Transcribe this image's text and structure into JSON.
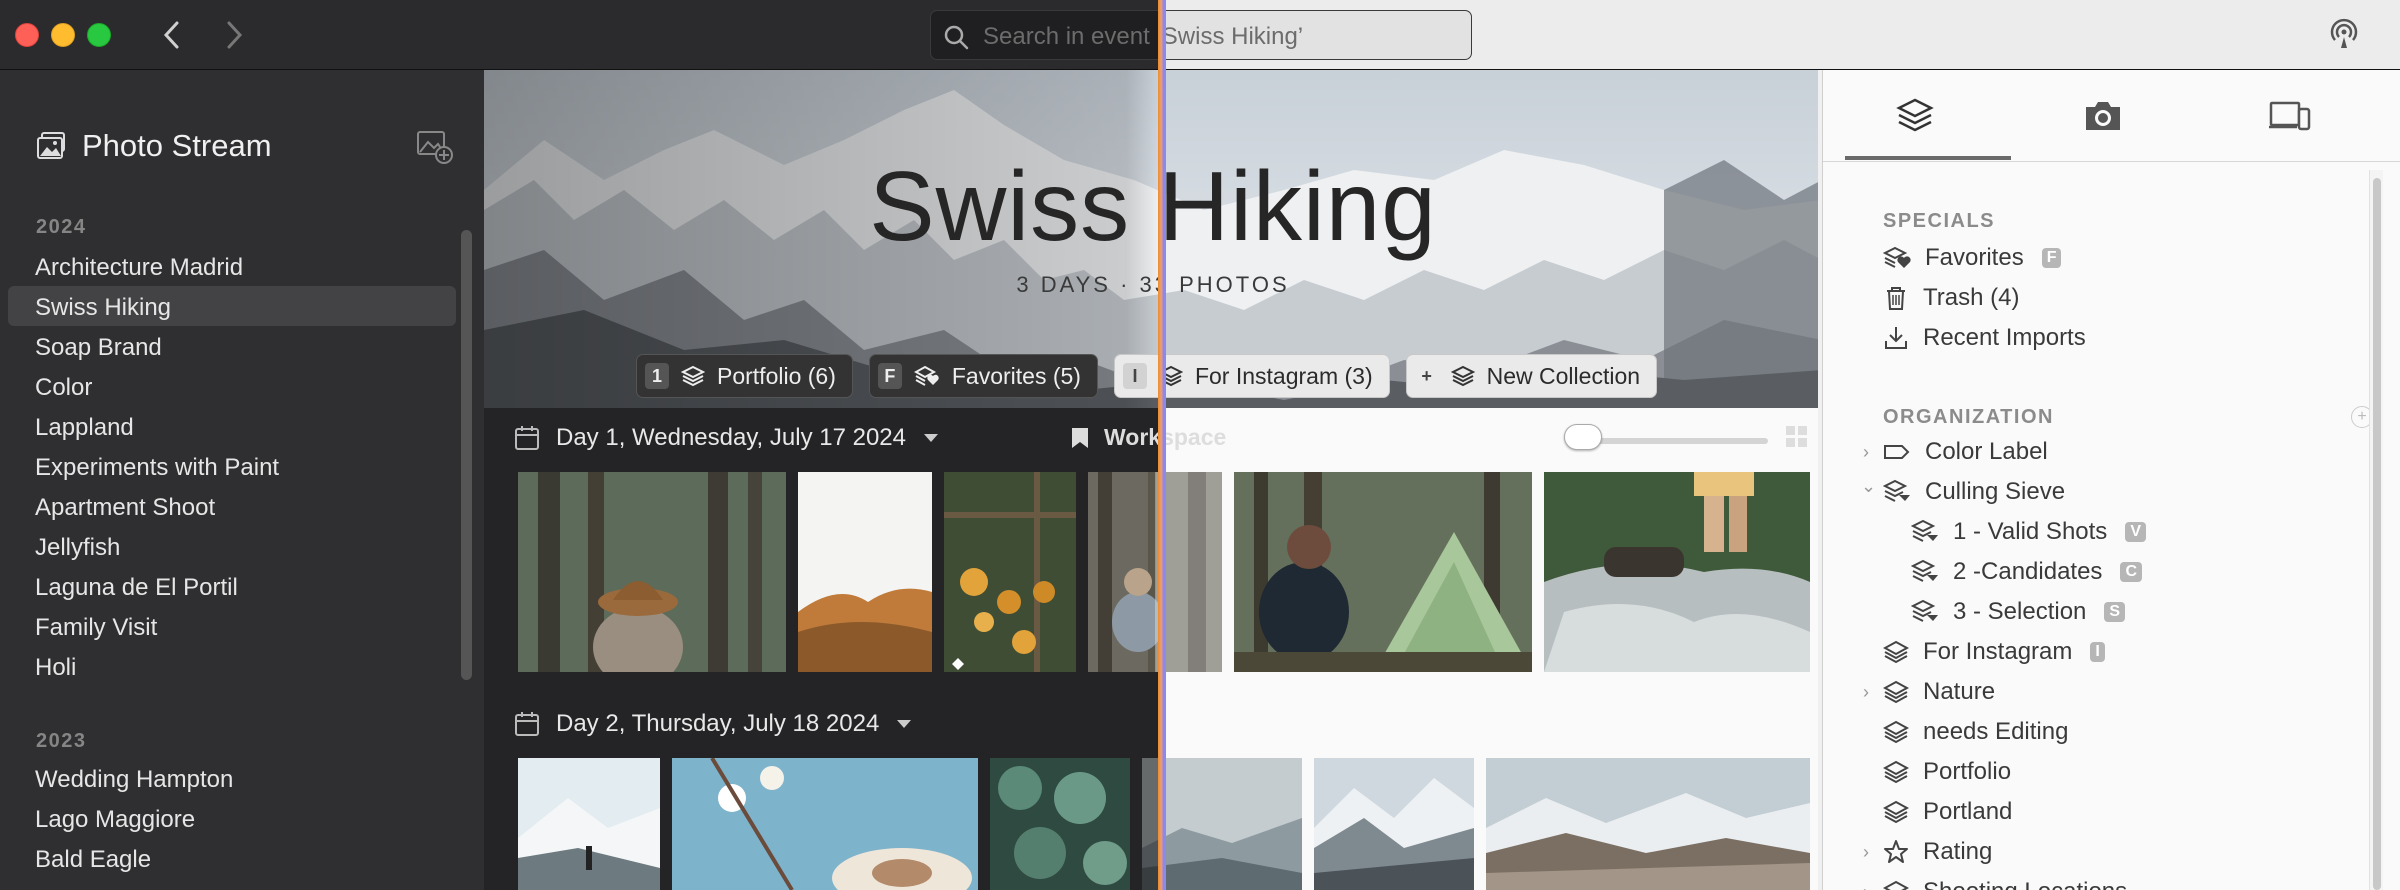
{
  "window": {
    "search_placeholder": "Search in event ‘Swiss Hiking’"
  },
  "sidebar": {
    "photo_stream": "Photo Stream",
    "groups": [
      {
        "year": "2024",
        "events": [
          "Architecture Madrid",
          "Swiss Hiking",
          "Soap Brand",
          "Color",
          "Lappland",
          "Experiments with Paint",
          "Apartment Shoot",
          "Jellyfish",
          "Laguna de El Portil",
          "Family Visit",
          "Holi"
        ]
      },
      {
        "year": "2023",
        "events": [
          "Wedding Hampton",
          "Lago Maggiore",
          "Bald Eagle"
        ]
      }
    ],
    "selected": "Swiss Hiking"
  },
  "hero": {
    "title": "Swiss Hiking",
    "subtitle": "3 DAYS · 33 PHOTOS",
    "chips": [
      {
        "key": "1",
        "label": "Portfolio (6)"
      },
      {
        "key": "F",
        "label": "Favorites (5)"
      },
      {
        "key": "I",
        "label": "For Instagram (3)"
      },
      {
        "key": "+",
        "label": "New Collection"
      }
    ]
  },
  "days": [
    {
      "label": "Day 1, Wednesday, July 17 2024"
    },
    {
      "label": "Day 2, Thursday, July 18 2024"
    }
  ],
  "workspace_label": "Workspace",
  "right_panel": {
    "specials_header": "SPECIALS",
    "specials": [
      {
        "label": "Favorites",
        "badge": "F",
        "icon": "favorites-icon"
      },
      {
        "label": "Trash (4)",
        "badge": "",
        "icon": "trash-icon"
      },
      {
        "label": "Recent Imports",
        "badge": "",
        "icon": "import-icon"
      }
    ],
    "organization_header": "ORGANIZATION",
    "organization": [
      {
        "label": "Color Label",
        "badge": "",
        "indent": 0,
        "chevron": "›",
        "icon": "label-icon"
      },
      {
        "label": "Culling Sieve",
        "badge": "",
        "indent": 0,
        "chevron": "⌄",
        "icon": "sieve-icon"
      },
      {
        "label": "1 - Valid Shots",
        "badge": "V",
        "indent": 1,
        "chevron": "",
        "icon": "sieve-icon"
      },
      {
        "label": "2 -Candidates",
        "badge": "C",
        "indent": 1,
        "chevron": "",
        "icon": "sieve-icon"
      },
      {
        "label": "3 - Selection",
        "badge": "S",
        "indent": 1,
        "chevron": "",
        "icon": "sieve-icon"
      },
      {
        "label": "For Instagram",
        "badge": "I",
        "indent": 0,
        "chevron": "",
        "icon": "collection-icon"
      },
      {
        "label": "Nature",
        "badge": "",
        "indent": 0,
        "chevron": "›",
        "icon": "collection-icon"
      },
      {
        "label": "needs Editing",
        "badge": "",
        "indent": 0,
        "chevron": "",
        "icon": "collection-icon"
      },
      {
        "label": "Portfolio",
        "badge": "",
        "indent": 0,
        "chevron": "",
        "icon": "collection-icon"
      },
      {
        "label": "Portland",
        "badge": "",
        "indent": 0,
        "chevron": "",
        "icon": "collection-icon"
      },
      {
        "label": "Rating",
        "badge": "",
        "indent": 0,
        "chevron": "›",
        "icon": "star-icon"
      },
      {
        "label": "Shooting Locations",
        "badge": "",
        "indent": 0,
        "chevron": "›",
        "icon": "collection-icon"
      }
    ]
  },
  "colors": {
    "accent_split": "#e3a17c",
    "dark_bg": "#2f2f31",
    "light_bg": "#fafafa"
  }
}
